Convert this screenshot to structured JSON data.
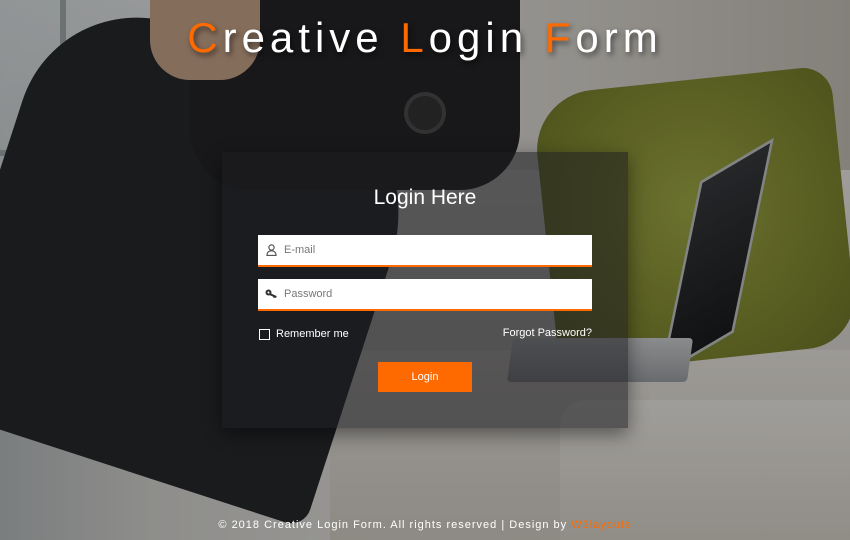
{
  "header": {
    "title_parts": [
      "C",
      "reative ",
      "L",
      "ogin ",
      "F",
      "orm"
    ]
  },
  "form": {
    "heading": "Login Here",
    "email": {
      "placeholder": "E-mail",
      "value": "",
      "icon": "user-icon"
    },
    "password": {
      "placeholder": "Password",
      "value": "",
      "icon": "key-icon"
    },
    "remember_label": "Remember me",
    "remember_checked": false,
    "forgot_label": "Forgot Password?",
    "submit_label": "Login"
  },
  "footer": {
    "text": "© 2018 Creative Login Form. All rights reserved | Design by ",
    "link_label": "W3layouts"
  },
  "colors": {
    "accent": "#ff6a00",
    "text": "#ffffff",
    "card_bg": "rgba(30,30,32,0.55)"
  }
}
